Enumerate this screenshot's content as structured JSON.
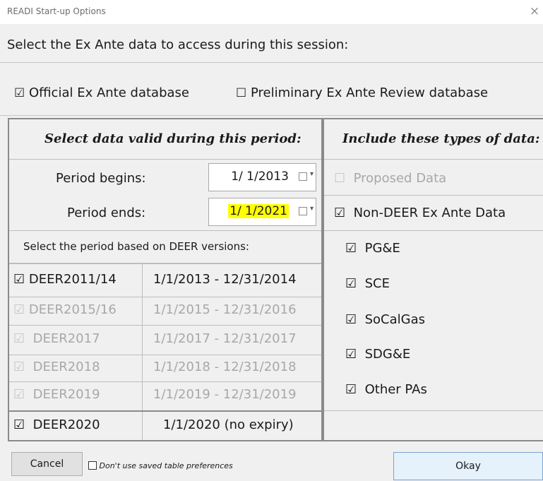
{
  "window": {
    "title": "READI Start-up Options",
    "close_glyph": "×"
  },
  "prompt": "Select the Ex Ante data to access during this session:",
  "database_options": [
    {
      "label": "Official Ex Ante database",
      "checked": true
    },
    {
      "label": "Preliminary Ex Ante Review database",
      "checked": false
    }
  ],
  "period": {
    "header": "Select data valid during this period:",
    "begins_label": "Period begins:",
    "begins_value": "1/ 1/2013",
    "ends_label": "Period ends:",
    "ends_value": "1/ 1/2021",
    "deer_caption": "Select the period based on DEER versions:"
  },
  "deer_versions": [
    {
      "name": "DEER2011/14",
      "range": "1/1/2013 - 12/31/2014",
      "checked": true,
      "enabled": true
    },
    {
      "name": "DEER2015/16",
      "range": "1/1/2015 - 12/31/2016",
      "checked": true,
      "enabled": false
    },
    {
      "name": "DEER2017",
      "range": "1/1/2017 - 12/31/2017",
      "checked": true,
      "enabled": false
    },
    {
      "name": "DEER2018",
      "range": "1/1/2018 - 12/31/2018",
      "checked": true,
      "enabled": false
    },
    {
      "name": "DEER2019",
      "range": "1/1/2019 - 12/31/2019",
      "checked": true,
      "enabled": false
    },
    {
      "name": "DEER2020",
      "range": "1/1/2020 (no expiry)",
      "checked": true,
      "enabled": true
    }
  ],
  "types": {
    "header": "Include these types of data:",
    "proposed": {
      "label": "Proposed Data",
      "checked": false,
      "enabled": false
    },
    "nondeer": {
      "label": "Non-DEER Ex Ante Data",
      "checked": true
    },
    "pas": [
      {
        "label": "PG&E",
        "checked": true
      },
      {
        "label": "SCE",
        "checked": true
      },
      {
        "label": "SoCalGas",
        "checked": true
      },
      {
        "label": "SDG&E",
        "checked": true
      },
      {
        "label": "Other PAs",
        "checked": true
      }
    ]
  },
  "footer": {
    "cancel_label": "Cancel",
    "no_prefs_label": "Don't use saved table preferences",
    "okay_label": "Okay"
  },
  "colors": {
    "highlight": "#ffff00",
    "dialog_bg": "#f0f0f0",
    "disabled_text": "#a8a8a8"
  },
  "icons": {
    "checked": "☑",
    "unchecked": "☐",
    "dropdown": "▾"
  }
}
